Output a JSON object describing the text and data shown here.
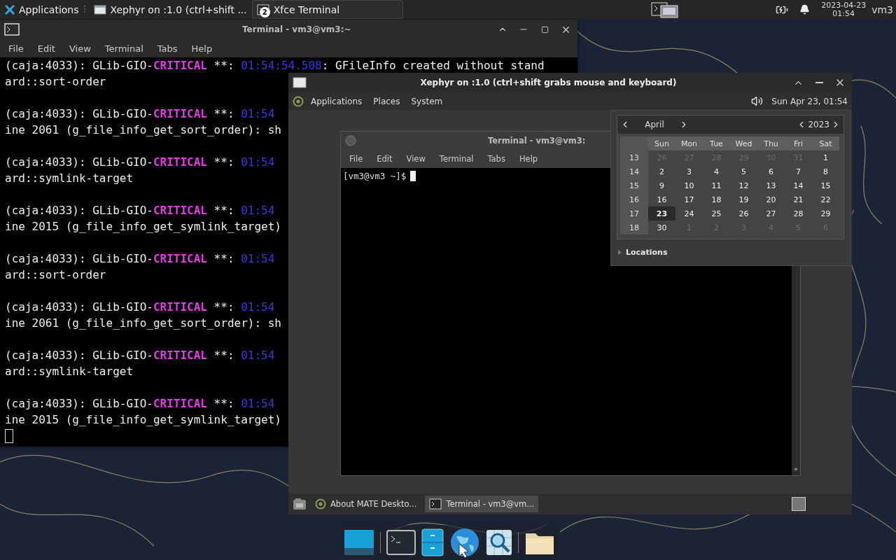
{
  "top_panel": {
    "apps_menu": "Applications",
    "tasks": [
      {
        "kind": "window",
        "label": "Xephyr on :1.0 (ctrl+shift ..."
      },
      {
        "kind": "terminal",
        "label": "Xfce Terminal",
        "badge": "2"
      }
    ],
    "clock": {
      "date": "2023-04-23",
      "time": "01:54"
    },
    "user": "vm3"
  },
  "terminal": {
    "title": "Terminal - vm3@vm3:~",
    "menu": [
      "File",
      "Edit",
      "View",
      "Terminal",
      "Tabs",
      "Help"
    ],
    "entries": [
      {
        "source": "(caja:4033): GLib-GIO-",
        "level": "CRITICAL",
        "separator": " **: ",
        "time": "01:54:54.508",
        "message": ": GFileInfo created without stand",
        "continuation": "ard::sort-order"
      },
      {
        "source": "(caja:4033): GLib-GIO-",
        "level": "CRITICAL",
        "separator": " **: ",
        "time": "01:54",
        "continuation": "ine 2061 (g_file_info_get_sort_order): sh"
      },
      {
        "source": "(caja:4033): GLib-GIO-",
        "level": "CRITICAL",
        "separator": " **: ",
        "time": "01:54",
        "continuation": "ard::symlink-target"
      },
      {
        "source": "(caja:4033): GLib-GIO-",
        "level": "CRITICAL",
        "separator": " **: ",
        "time": "01:54",
        "continuation": "ine 2015 (g_file_info_get_symlink_target)"
      },
      {
        "source": "(caja:4033): GLib-GIO-",
        "level": "CRITICAL",
        "separator": " **: ",
        "time": "01:54",
        "continuation": "ard::sort-order"
      },
      {
        "source": "(caja:4033): GLib-GIO-",
        "level": "CRITICAL",
        "separator": " **: ",
        "time": "01:54",
        "continuation": "ine 2061 (g_file_info_get_sort_order): sh"
      },
      {
        "source": "(caja:4033): GLib-GIO-",
        "level": "CRITICAL",
        "separator": " **: ",
        "time": "01:54",
        "continuation": "ard::symlink-target"
      },
      {
        "source": "(caja:4033): GLib-GIO-",
        "level": "CRITICAL",
        "separator": " **: ",
        "time": "01:54",
        "continuation": "ine 2015 (g_file_info_get_symlink_target)"
      }
    ]
  },
  "xephyr": {
    "title": "Xephyr on :1.0 (ctrl+shift grabs mouse and keyboard)",
    "panel": {
      "menus": [
        "Applications",
        "Places",
        "System"
      ],
      "clock": "Sun Apr 23, 01:54"
    },
    "terminal": {
      "title": "Terminal - vm3@vm3:",
      "menu": [
        "File",
        "Edit",
        "View",
        "Terminal",
        "Tabs",
        "Help"
      ],
      "prompt": "[vm3@vm3 ~]$"
    },
    "calendar": {
      "month": "April",
      "year": "2023",
      "weekdays": [
        "Sun",
        "Mon",
        "Tue",
        "Wed",
        "Thu",
        "Fri",
        "Sat"
      ],
      "weeks": [
        {
          "week": "13",
          "days": [
            {
              "d": "26",
              "in_month": false,
              "selected": false
            },
            {
              "d": "27",
              "in_month": false,
              "selected": false
            },
            {
              "d": "28",
              "in_month": false,
              "selected": false
            },
            {
              "d": "29",
              "in_month": false,
              "selected": false
            },
            {
              "d": "30",
              "in_month": false,
              "selected": false
            },
            {
              "d": "31",
              "in_month": false,
              "selected": false
            },
            {
              "d": "1",
              "in_month": true,
              "selected": false
            }
          ]
        },
        {
          "week": "14",
          "days": [
            {
              "d": "2",
              "in_month": true,
              "selected": false
            },
            {
              "d": "3",
              "in_month": true,
              "selected": false
            },
            {
              "d": "4",
              "in_month": true,
              "selected": false
            },
            {
              "d": "5",
              "in_month": true,
              "selected": false
            },
            {
              "d": "6",
              "in_month": true,
              "selected": false
            },
            {
              "d": "7",
              "in_month": true,
              "selected": false
            },
            {
              "d": "8",
              "in_month": true,
              "selected": false
            }
          ]
        },
        {
          "week": "15",
          "days": [
            {
              "d": "9",
              "in_month": true,
              "selected": false
            },
            {
              "d": "10",
              "in_month": true,
              "selected": false
            },
            {
              "d": "11",
              "in_month": true,
              "selected": false
            },
            {
              "d": "12",
              "in_month": true,
              "selected": false
            },
            {
              "d": "13",
              "in_month": true,
              "selected": false
            },
            {
              "d": "14",
              "in_month": true,
              "selected": false
            },
            {
              "d": "15",
              "in_month": true,
              "selected": false
            }
          ]
        },
        {
          "week": "16",
          "days": [
            {
              "d": "16",
              "in_month": true,
              "selected": false
            },
            {
              "d": "17",
              "in_month": true,
              "selected": false
            },
            {
              "d": "18",
              "in_month": true,
              "selected": false
            },
            {
              "d": "19",
              "in_month": true,
              "selected": false
            },
            {
              "d": "20",
              "in_month": true,
              "selected": false
            },
            {
              "d": "21",
              "in_month": true,
              "selected": false
            },
            {
              "d": "22",
              "in_month": true,
              "selected": false
            }
          ]
        },
        {
          "week": "17",
          "days": [
            {
              "d": "23",
              "in_month": true,
              "selected": true
            },
            {
              "d": "24",
              "in_month": true,
              "selected": false
            },
            {
              "d": "25",
              "in_month": true,
              "selected": false
            },
            {
              "d": "26",
              "in_month": true,
              "selected": false
            },
            {
              "d": "27",
              "in_month": true,
              "selected": false
            },
            {
              "d": "28",
              "in_month": true,
              "selected": false
            },
            {
              "d": "29",
              "in_month": true,
              "selected": false
            }
          ]
        },
        {
          "week": "18",
          "days": [
            {
              "d": "30",
              "in_month": true,
              "selected": false
            },
            {
              "d": "1",
              "in_month": false,
              "selected": false
            },
            {
              "d": "2",
              "in_month": false,
              "selected": false
            },
            {
              "d": "3",
              "in_month": false,
              "selected": false
            },
            {
              "d": "4",
              "in_month": false,
              "selected": false
            },
            {
              "d": "5",
              "in_month": false,
              "selected": false
            },
            {
              "d": "6",
              "in_month": false,
              "selected": false
            }
          ]
        }
      ],
      "locations": "Locations"
    },
    "taskbar": [
      {
        "kind": "about",
        "label": "About MATE Deskto...",
        "selected": false
      },
      {
        "kind": "terminal",
        "label": "Terminal - vm3@vm...",
        "selected": true
      }
    ]
  },
  "dock": [
    {
      "kind": "desktop"
    },
    {
      "kind": "terminal"
    },
    {
      "kind": "files"
    },
    {
      "kind": "web"
    },
    {
      "kind": "search"
    },
    {
      "kind": "folder"
    }
  ]
}
